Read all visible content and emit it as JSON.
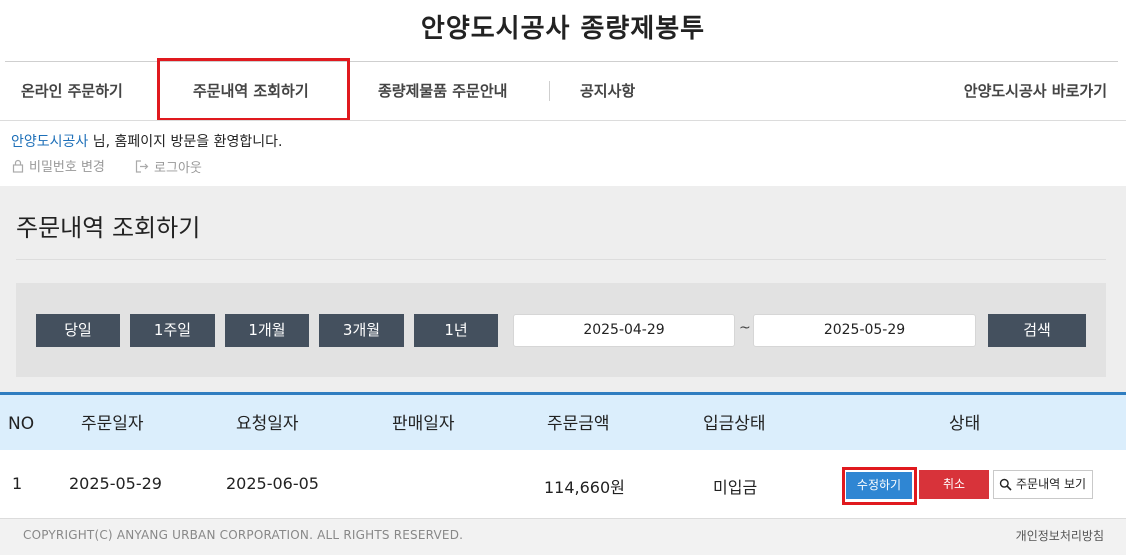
{
  "site": {
    "title": "안양도시공사 종량제봉투"
  },
  "nav": {
    "items": [
      "온라인 주문하기",
      "주문내역 조회하기",
      "종량제물품 주문안내",
      "공지사항"
    ],
    "right_link": "안양도시공사 바로가기"
  },
  "welcome": {
    "user": "안양도시공사",
    "message": " 님, 홈페이지 방문을 환영합니다.",
    "change_password": "비밀번호 변경",
    "logout": "로그아웃"
  },
  "page": {
    "title": "주문내역 조회하기"
  },
  "search": {
    "periods": [
      "당일",
      "1주일",
      "1개월",
      "3개월",
      "1년"
    ],
    "date_from": "2025-04-29",
    "separator": "~",
    "date_to": "2025-05-29",
    "search_label": "검색"
  },
  "table": {
    "headers": [
      "NO",
      "주문일자",
      "요청일자",
      "판매일자",
      "주문금액",
      "입금상태",
      "상태"
    ],
    "rows": [
      {
        "no": "1",
        "order_date": "2025-05-29",
        "request_date": "2025-06-05",
        "sale_date": "",
        "amount": "114,660원",
        "payment_status": "미입금"
      }
    ],
    "actions": {
      "edit": "수정하기",
      "cancel": "취소",
      "view": "주문내역 보기"
    }
  },
  "footer": {
    "copyright": "COPYRIGHT(C) ANYANG URBAN CORPORATION. ALL RIGHTS RESERVED.",
    "privacy": "개인정보처리방침"
  },
  "colors": {
    "highlight": "#e0191e",
    "period_button": "#44505e",
    "edit_button": "#2f86d3",
    "cancel_button": "#d8333a",
    "table_header_bg": "#dbeefc",
    "table_header_border": "#2f7dc0"
  }
}
